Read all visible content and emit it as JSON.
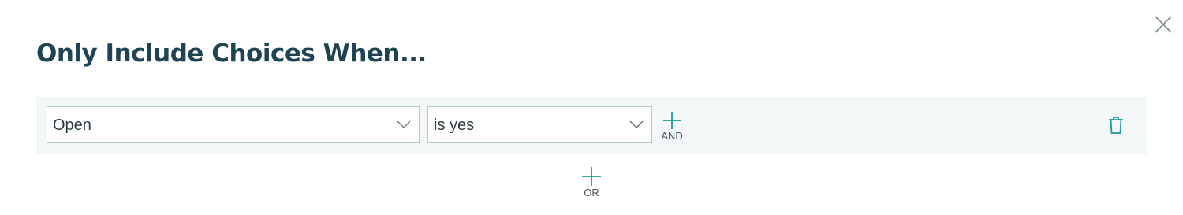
{
  "dialog": {
    "title": "Only Include Choices When...",
    "close_icon": "close-icon"
  },
  "condition": {
    "field_value": "Open",
    "operator_value": "is yes",
    "and_label": "AND",
    "delete_icon": "trash-icon"
  },
  "or_label": "OR",
  "colors": {
    "title": "#1f4352",
    "accent": "#1a9a94",
    "row_background": "#f3f7f8",
    "select_border": "#b9c7cc",
    "muted_text": "#43555c"
  }
}
